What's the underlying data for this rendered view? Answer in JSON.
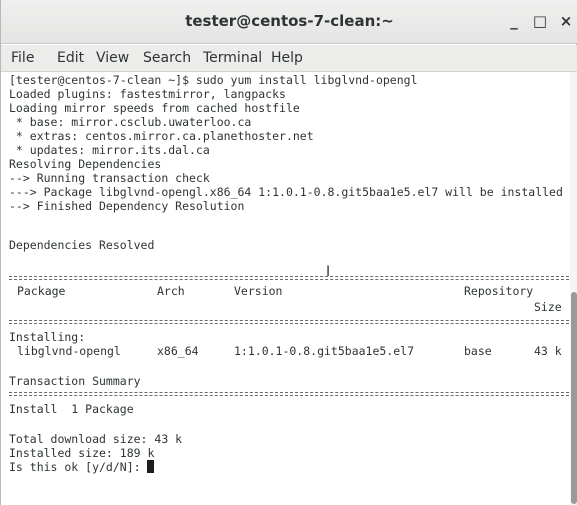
{
  "window": {
    "title": "tester@centos-7-clean:~",
    "minimize_label": "_",
    "maximize_label": "□",
    "close_label": "×"
  },
  "menu": {
    "items": [
      "File",
      "Edit",
      "View",
      "Search",
      "Terminal",
      "Help"
    ]
  },
  "terminal": {
    "lines": [
      "[tester@centos-7-clean ~]$ sudo yum install libglvnd-opengl",
      "Loaded plugins: fastestmirror, langpacks",
      "Loading mirror speeds from cached hostfile",
      " * base: mirror.csclub.uwaterloo.ca",
      " * extras: centos.mirror.ca.planethoster.net",
      " * updates: mirror.its.dal.ca",
      "Resolving Dependencies",
      "--> Running transaction check",
      "---> Package libglvnd-opengl.x86_64 1:1.0.1-0.8.git5baa1e5.el7 will be installed",
      "--> Finished Dependency Resolution",
      "",
      "Dependencies Resolved"
    ],
    "table": {
      "headers": [
        "Package",
        "Arch",
        "Version",
        "Repository",
        "Size"
      ],
      "section_label": "Installing:",
      "rows": [
        [
          "libglvnd-opengl",
          "x86_64",
          "1:1.0.1-0.8.git5baa1e5.el7",
          "base",
          "43 k"
        ]
      ]
    },
    "summary": {
      "title": "Transaction Summary",
      "install_line": "Install  1 Package",
      "total_download": "Total download size: 43 k",
      "installed_size": "Installed size: 189 k",
      "prompt": "Is this ok [y/d/N]: "
    },
    "mouse_cursor": "I"
  }
}
